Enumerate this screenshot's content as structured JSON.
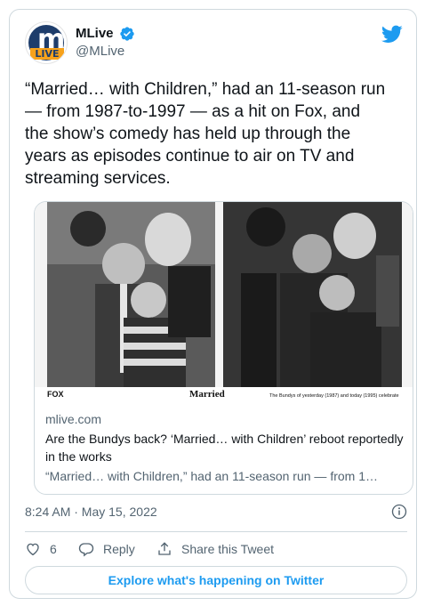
{
  "account": {
    "display_name": "MLive",
    "handle": "@MLive",
    "avatar_logo_text": "m",
    "avatar_logo_sub": "LIVE"
  },
  "tweet": {
    "text": "“Married… with Children,” had an 11-season run\n— from 1987-to-1997 — as a hit on Fox, and\nthe show’s comedy has held up through the\nyears as episodes continue to air on TV and\nstreaming services."
  },
  "link_card": {
    "domain": "mlive.com",
    "title": "Are the Bundys back? ‘Married… with Children’ reboot reportedly in the works",
    "description": "“Married… with Children,” had an 11-season run — from 1…",
    "image_caption_left": "FOX",
    "image_caption_center": "Married",
    "image_caption_right": "The Bundys of yesterday (1987) and today (1995) celebrate"
  },
  "timestamp": "8:24 AM · May 15, 2022",
  "actions": {
    "like_count": "6",
    "reply_label": "Reply",
    "share_label": "Share this Tweet"
  },
  "explore_label": "Explore what's happening on Twitter",
  "colors": {
    "brand_blue": "#1d9bf0",
    "text_primary": "#0f1419",
    "text_secondary": "#536471",
    "border": "#cfd9de"
  },
  "icons": [
    "verified-badge-icon",
    "twitter-bird-icon",
    "info-icon",
    "heart-icon",
    "reply-icon",
    "share-icon"
  ]
}
